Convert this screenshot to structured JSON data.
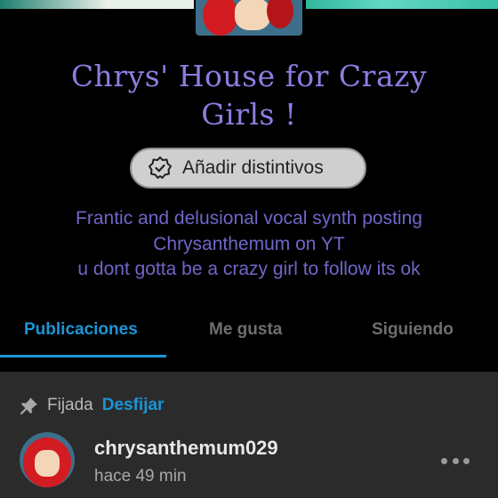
{
  "blog": {
    "title_line1": "Chrys' House for Crazy",
    "title_line2": "Girls !",
    "badge_button_label": "Añadir distintivos",
    "description_lines": [
      "Frantic and delusional vocal synth posting",
      "Chrysanthemum on YT",
      "u dont gotta be a crazy girl to follow its ok"
    ]
  },
  "tabs": [
    {
      "label": "Publicaciones",
      "active": true
    },
    {
      "label": "Me gusta",
      "active": false
    },
    {
      "label": "Siguiendo",
      "active": false
    }
  ],
  "post": {
    "pinned_label": "Fijada",
    "unpin_label": "Desfijar",
    "username": "chrysanthemum029",
    "timestamp": "hace 49 min"
  },
  "icons": {
    "badge": "badge-icon",
    "pin": "pin-icon",
    "more": "more-options-icon"
  },
  "colors": {
    "accent_blue": "#1b95d6",
    "title_purple": "#8a7ee0",
    "description_purple": "#7066c8",
    "background": "#000000",
    "post_card": "#2b2b2b"
  }
}
